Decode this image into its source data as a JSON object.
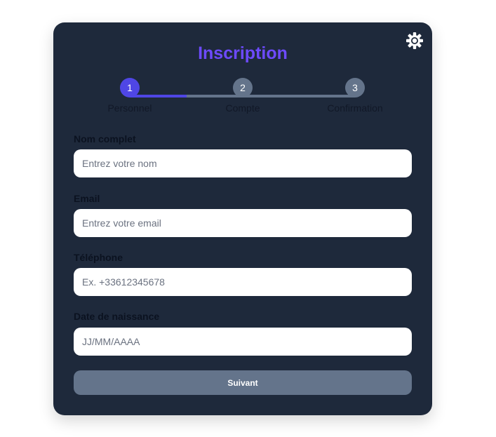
{
  "form": {
    "title": "Inscription",
    "theme_icon": "gear-icon",
    "accent_color": "#6d4aff",
    "card_color": "#1e293b",
    "progress": 0.25
  },
  "steps": [
    {
      "number": "1",
      "label": "Personnel",
      "state": "active"
    },
    {
      "number": "2",
      "label": "Compte",
      "state": "inactive"
    },
    {
      "number": "3",
      "label": "Confirmation",
      "state": "inactive"
    }
  ],
  "fields": {
    "full_name": {
      "label": "Nom complet",
      "placeholder": "Entrez votre nom",
      "value": ""
    },
    "email": {
      "label": "Email",
      "placeholder": "Entrez votre email",
      "value": ""
    },
    "phone": {
      "label": "Téléphone",
      "placeholder": "Ex. +33612345678",
      "value": ""
    },
    "birth_date": {
      "label": "Date de naissance",
      "placeholder": "JJ/MM/AAAA",
      "value": ""
    }
  },
  "actions": {
    "next_label": "Suivant"
  }
}
